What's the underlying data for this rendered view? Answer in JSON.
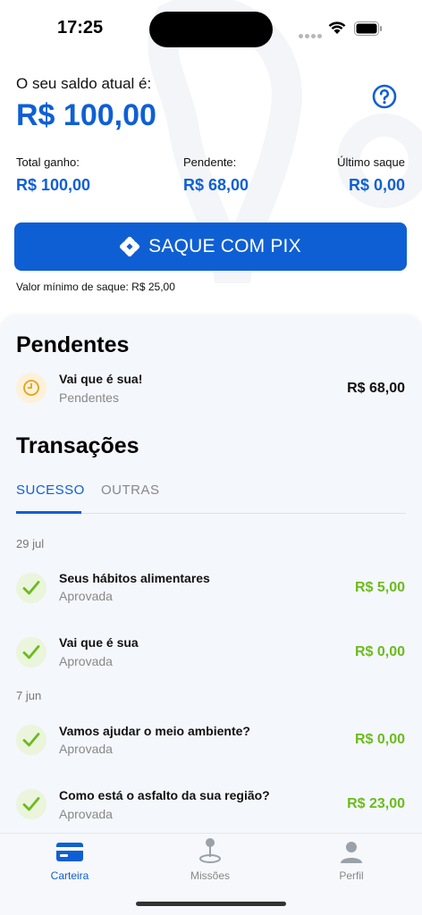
{
  "status": {
    "time": "17:25"
  },
  "balance": {
    "label": "O seu saldo atual é:",
    "value": "R$ 100,00"
  },
  "stats": [
    {
      "label": "Total ganho:",
      "value": "R$ 100,00"
    },
    {
      "label": "Pendente:",
      "value": "R$ 68,00"
    },
    {
      "label": "Último saque",
      "value": "R$ 0,00"
    }
  ],
  "pix": {
    "label": "SAQUE COM PIX",
    "min_note": "Valor mínimo de saque: R$ 25,00"
  },
  "pending": {
    "title": "Pendentes",
    "items": [
      {
        "title": "Vai que é sua!",
        "status": "Pendentes",
        "amount": "R$ 68,00"
      }
    ]
  },
  "transactions": {
    "title": "Transações",
    "tabs": [
      "SUCESSO",
      "OUTRAS"
    ],
    "groups": [
      {
        "date": "29 jul",
        "items": [
          {
            "title": "Seus hábitos alimentares",
            "status": "Aprovada",
            "amount": "R$ 5,00"
          },
          {
            "title": "Vai que é sua",
            "status": "Aprovada",
            "amount": "R$ 0,00"
          }
        ]
      },
      {
        "date": "7 jun",
        "items": [
          {
            "title": "Vamos ajudar o meio ambiente?",
            "status": "Aprovada",
            "amount": "R$ 0,00"
          },
          {
            "title": "Como está o asfalto da sua região?",
            "status": "Aprovada",
            "amount": "R$ 23,00"
          }
        ]
      }
    ]
  },
  "nav": {
    "items": [
      "Carteira",
      "Missões",
      "Perfil"
    ]
  },
  "colors": {
    "accent": "#0f5fd4",
    "success": "#6cbb1d",
    "pending": "#e0a31c"
  },
  "icons": [
    "help-icon",
    "pix-icon",
    "clock-icon",
    "check-icon",
    "wallet-icon",
    "map-pin-icon",
    "profile-icon"
  ]
}
